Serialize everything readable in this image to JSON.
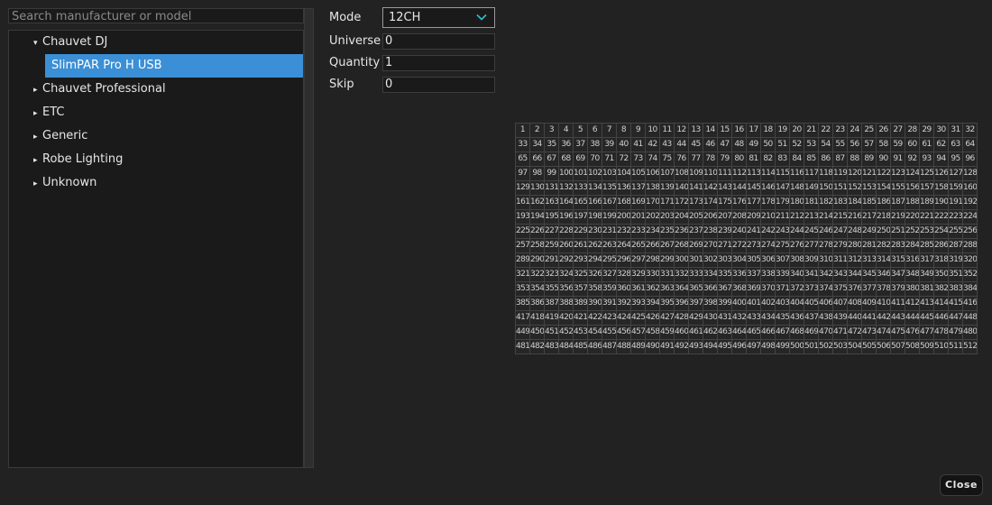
{
  "search": {
    "placeholder": "Search manufacturer or model"
  },
  "tree": {
    "items": [
      {
        "label": "Chauvet DJ",
        "expanded": true,
        "level": 0
      },
      {
        "label": "SlimPAR Pro H USB",
        "level": 1,
        "selected": true
      },
      {
        "label": "Chauvet Professional",
        "expanded": false,
        "level": 0
      },
      {
        "label": "ETC",
        "expanded": false,
        "level": 0
      },
      {
        "label": "Generic",
        "expanded": false,
        "level": 0
      },
      {
        "label": "Robe Lighting",
        "expanded": false,
        "level": 0
      },
      {
        "label": "Unknown",
        "expanded": false,
        "level": 0
      }
    ],
    "expanded_arrow": "▾",
    "collapsed_arrow": "▸"
  },
  "form": {
    "mode": {
      "label": "Mode",
      "value": "12CH"
    },
    "universe": {
      "label": "Universe",
      "value": "0"
    },
    "quantity": {
      "label": "Quantity",
      "value": "1"
    },
    "skip": {
      "label": "Skip",
      "value": "0"
    }
  },
  "channel_grid": {
    "start": 1,
    "count": 512,
    "columns": 32
  },
  "close_label": "Close",
  "colors": {
    "accent": "#3b8fd6",
    "chevron": "#2fc0d0"
  }
}
